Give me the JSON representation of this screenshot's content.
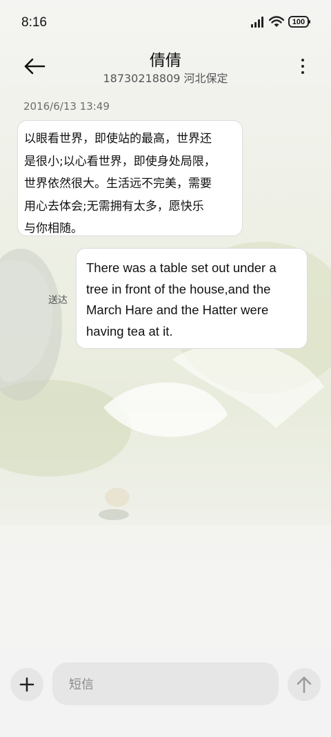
{
  "status_bar": {
    "time": "8:16",
    "battery": "100"
  },
  "header": {
    "contact_name": "倩倩",
    "contact_detail": "18730218809 河北保定"
  },
  "conversation": {
    "timestamp": "2016/6/13 13:49",
    "messages": [
      {
        "direction": "incoming",
        "lines": [
          "以眼看世界，即使站的最高，世界还",
          "是很小;以心看世界，即使身处局限，",
          "世界依然很大。生活远不完美，需要",
          "用心去体会;无需拥有太多，愿快乐",
          "与你相随。"
        ]
      },
      {
        "direction": "outgoing",
        "status": "送达",
        "lines": [
          "There was a table set out under a",
          "tree in front of the house,and the",
          "March Hare and the Hatter were",
          "having tea at it."
        ]
      }
    ]
  },
  "composer": {
    "placeholder": "短信"
  },
  "icons": {
    "back": "arrow-left-icon",
    "more": "more-vertical-icon",
    "add": "plus-icon",
    "send": "arrow-up-icon",
    "signal": "signal-icon",
    "wifi": "wifi-icon",
    "battery": "battery-icon"
  }
}
